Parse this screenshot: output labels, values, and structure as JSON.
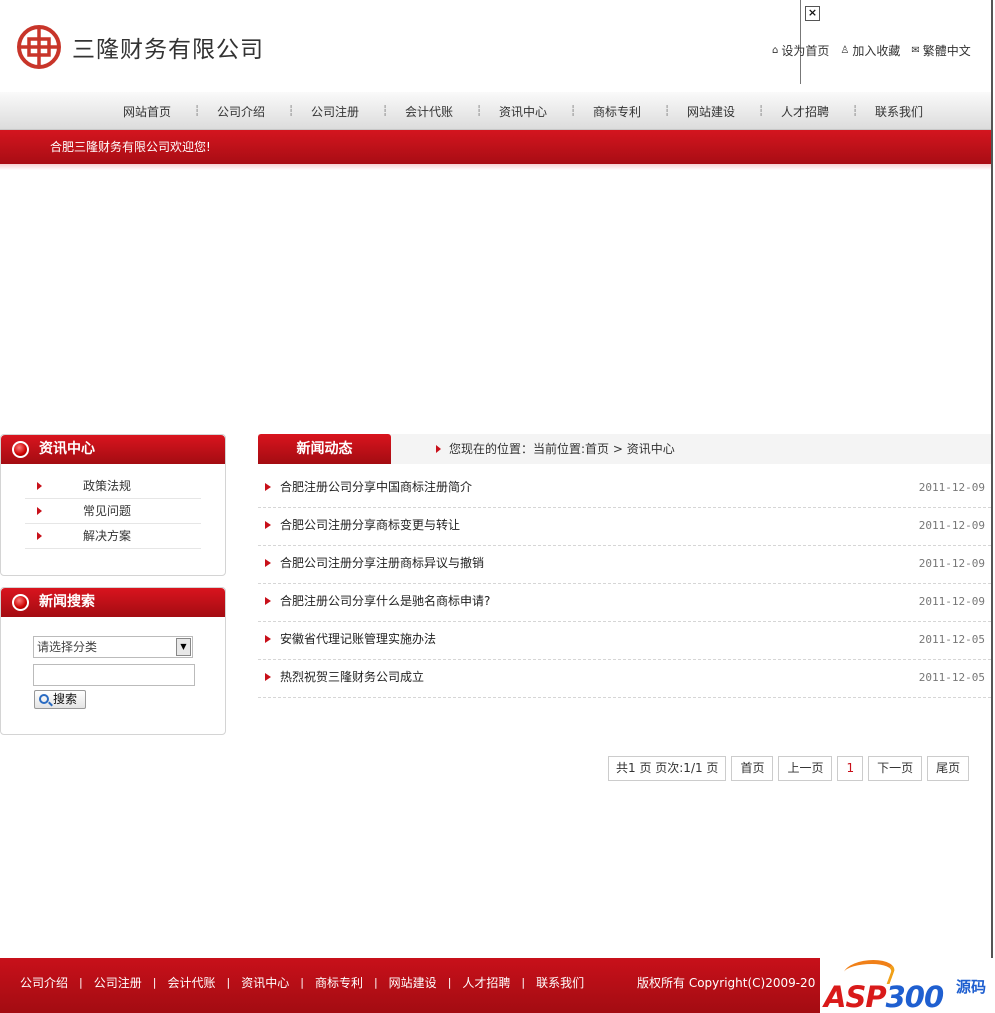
{
  "header": {
    "logo_text": "三隆财务有限公司",
    "close_glyph": "×",
    "top_links": [
      {
        "label": "设为首页",
        "icon": "home-icon"
      },
      {
        "label": "加入收藏",
        "icon": "bookmark-icon"
      },
      {
        "label": "繁體中文",
        "icon": "language-icon"
      }
    ]
  },
  "nav": {
    "items": [
      "网站首页",
      "公司介绍",
      "公司注册",
      "会计代账",
      "资讯中心",
      "商标专利",
      "网站建设",
      "人才招聘",
      "联系我们"
    ],
    "separator": "┆"
  },
  "welcome": "合肥三隆财务有限公司欢迎您!",
  "sidebar": {
    "info_title": "资讯中心",
    "categories": [
      "政策法规",
      "常见问题",
      "解决方案"
    ],
    "search_title": "新闻搜索",
    "select_value": "请选择分类",
    "search_button": "搜索"
  },
  "main": {
    "tab": "新闻动态",
    "breadcrumb": "您现在的位置：当前位置:首页 > 资讯中心",
    "news": [
      {
        "title": "合肥注册公司分享中国商标注册简介",
        "date": "2011-12-09"
      },
      {
        "title": "合肥公司注册分享商标变更与转让",
        "date": "2011-12-09"
      },
      {
        "title": "合肥公司注册分享注册商标异议与撤销",
        "date": "2011-12-09"
      },
      {
        "title": "合肥注册公司分享什么是驰名商标申请?",
        "date": "2011-12-09"
      },
      {
        "title": "安徽省代理记账管理实施办法",
        "date": "2011-12-05"
      },
      {
        "title": "热烈祝贺三隆财务公司成立",
        "date": "2011-12-05"
      }
    ],
    "pager": {
      "info": "共1 页 页次:1/1 页",
      "first": "首页",
      "prev": "上一页",
      "current": "1",
      "next": "下一页",
      "last": "尾页"
    }
  },
  "footer": {
    "links": [
      "公司介绍",
      "公司注册",
      "会计代账",
      "资讯中心",
      "商标专利",
      "网站建设",
      "人才招聘",
      "联系我们"
    ],
    "separator": "|",
    "copyright": "版权所有 Copyright(C)2009-20",
    "watermark_asp": "ASP",
    "watermark_num": "300",
    "watermark_cn": "源码"
  },
  "colors": {
    "brand_red": "#c8101a",
    "footer_red": "#b20d15"
  }
}
